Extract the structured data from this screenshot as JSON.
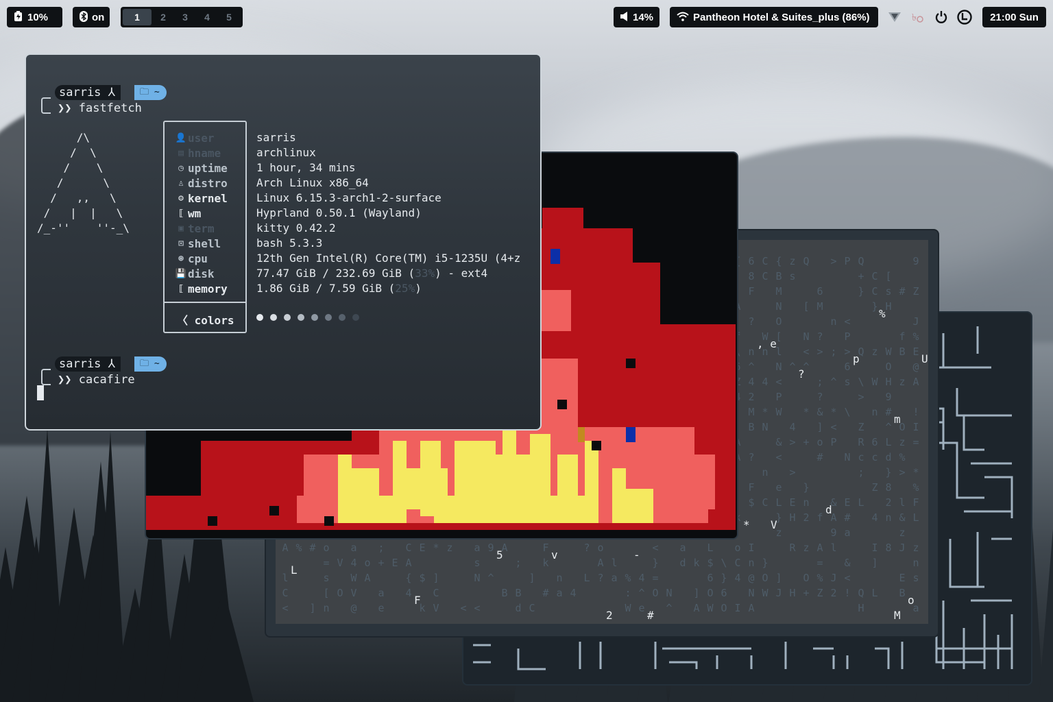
{
  "topbar": {
    "battery": {
      "icon": "battery-charging-icon",
      "value": "10%"
    },
    "bluetooth": {
      "icon": "bluetooth-icon",
      "value": "on"
    },
    "workspaces": [
      "1",
      "2",
      "3",
      "4",
      "5"
    ],
    "active_workspace": "1",
    "volume": {
      "icon": "speaker-icon",
      "value": "14%"
    },
    "wifi": {
      "icon": "wifi-icon",
      "value": "Pantheon Hotel & Suites_plus (86%)"
    },
    "tray_icons": [
      "vpn-icon",
      "input-method-icon",
      "power-icon",
      "clock-app-icon"
    ],
    "clock": "21:00 Sun"
  },
  "terminal": {
    "prompt1": {
      "user": "sarris",
      "user_glyph": "⅄",
      "dir_glyph": "🗀",
      "dir": "~",
      "arrow": "❯❯",
      "command": "fastfetch"
    },
    "logo_lines": [
      "      /\\",
      "     /  \\",
      "    /    \\",
      "   /      \\",
      "  /   ,,   \\",
      " /   |  |   \\",
      "/_-''    ''-_\\"
    ],
    "fastfetch": [
      {
        "key": "user",
        "icon": "user-icon",
        "value": "sarris",
        "dim": true
      },
      {
        "key": "hname",
        "icon": "host-icon",
        "value": "archlinux",
        "dim": true
      },
      {
        "key": "uptime",
        "icon": "clock-icon",
        "value": "1 hour, 34 mins",
        "dim": false
      },
      {
        "key": "distro",
        "icon": "tux-icon",
        "value": "Arch Linux x86_64",
        "dim": false
      },
      {
        "key": "kernel",
        "icon": "gear-icon",
        "value": "Linux 6.15.3-arch1-2-surface",
        "dim": false,
        "bright": true
      },
      {
        "key": "wm",
        "icon": "window-icon",
        "value": "Hyprland 0.50.1 (Wayland)",
        "dim": false,
        "bright": true
      },
      {
        "key": "term",
        "icon": "terminal-icon",
        "value": "kitty 0.42.2",
        "dim": true
      },
      {
        "key": "shell",
        "icon": "shell-icon",
        "value": "bash 5.3.3",
        "dim": false
      },
      {
        "key": "cpu",
        "icon": "chip-icon",
        "value": "12th Gen Intel(R) Core(TM) i5-1235U (4+z",
        "dim": false
      },
      {
        "key": "disk",
        "icon": "disk-icon",
        "value_pre": "77.47 GiB / 232.69 GiB (",
        "value_pct": "33%",
        "value_post": ") - ext4",
        "dim": false
      },
      {
        "key": "memory",
        "icon": "memory-icon",
        "value_pre": "1.86 GiB / 7.59 GiB (",
        "value_pct": "25%",
        "value_post": ")",
        "dim": false,
        "bright": true
      }
    ],
    "colors_label": "colors",
    "colors_glyph": "〈",
    "color_dots": [
      "#e6eaee",
      "#d9dee3",
      "#c8ced4",
      "#b3bbc3",
      "#8f99a3",
      "#6e7883",
      "#56616c",
      "#3e4852"
    ],
    "prompt2": {
      "user": "sarris",
      "user_glyph": "⅄",
      "dir_glyph": "🗀",
      "dir": "~",
      "arrow": "❯❯",
      "command": "cacafire"
    }
  },
  "matrix": {
    "bright_chars": [
      "%",
      ", e",
      "p",
      "U",
      "?",
      "m",
      "d",
      "*",
      "V",
      "5",
      "v",
      "-",
      "L",
      "F",
      "o",
      "2",
      "#",
      "M"
    ]
  },
  "colors": {
    "accent": "#6fb1e6",
    "bar_bg": "#0f1215",
    "fire_red": "#b8121a",
    "fire_salmon": "#f0605e",
    "fire_yellow": "#f5e960"
  }
}
